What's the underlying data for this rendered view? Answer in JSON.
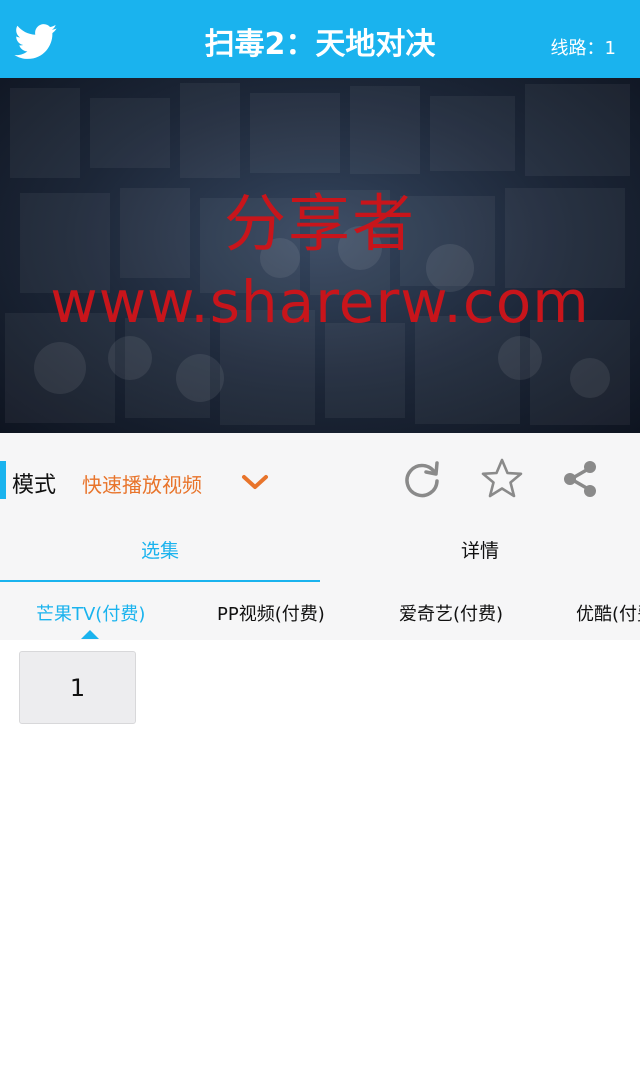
{
  "header": {
    "title": "扫毒2：天地对决",
    "line_label": "线路：1",
    "logo_icon": "bird-icon"
  },
  "banner": {
    "watermark_line1": "分享者",
    "watermark_line2": "www.sharerw.com"
  },
  "mode": {
    "label": "模式",
    "value": "快速播放视频",
    "dropdown_icon": "chevron-down-icon",
    "actions": [
      "refresh-icon",
      "star-icon",
      "share-icon"
    ]
  },
  "tabs": [
    {
      "label": "选集",
      "active": true
    },
    {
      "label": "详情",
      "active": false
    }
  ],
  "sources": [
    {
      "label": "芒果TV(付费)",
      "active": true
    },
    {
      "label": "PP视频(付费)",
      "active": false
    },
    {
      "label": "爱奇艺(付费)",
      "active": false
    },
    {
      "label": "优酷(付费)",
      "active": false
    }
  ],
  "episodes": [
    "1"
  ],
  "colors": {
    "accent": "#1ab3ee",
    "mode_value": "#e8742b",
    "watermark": "#c8151b"
  }
}
